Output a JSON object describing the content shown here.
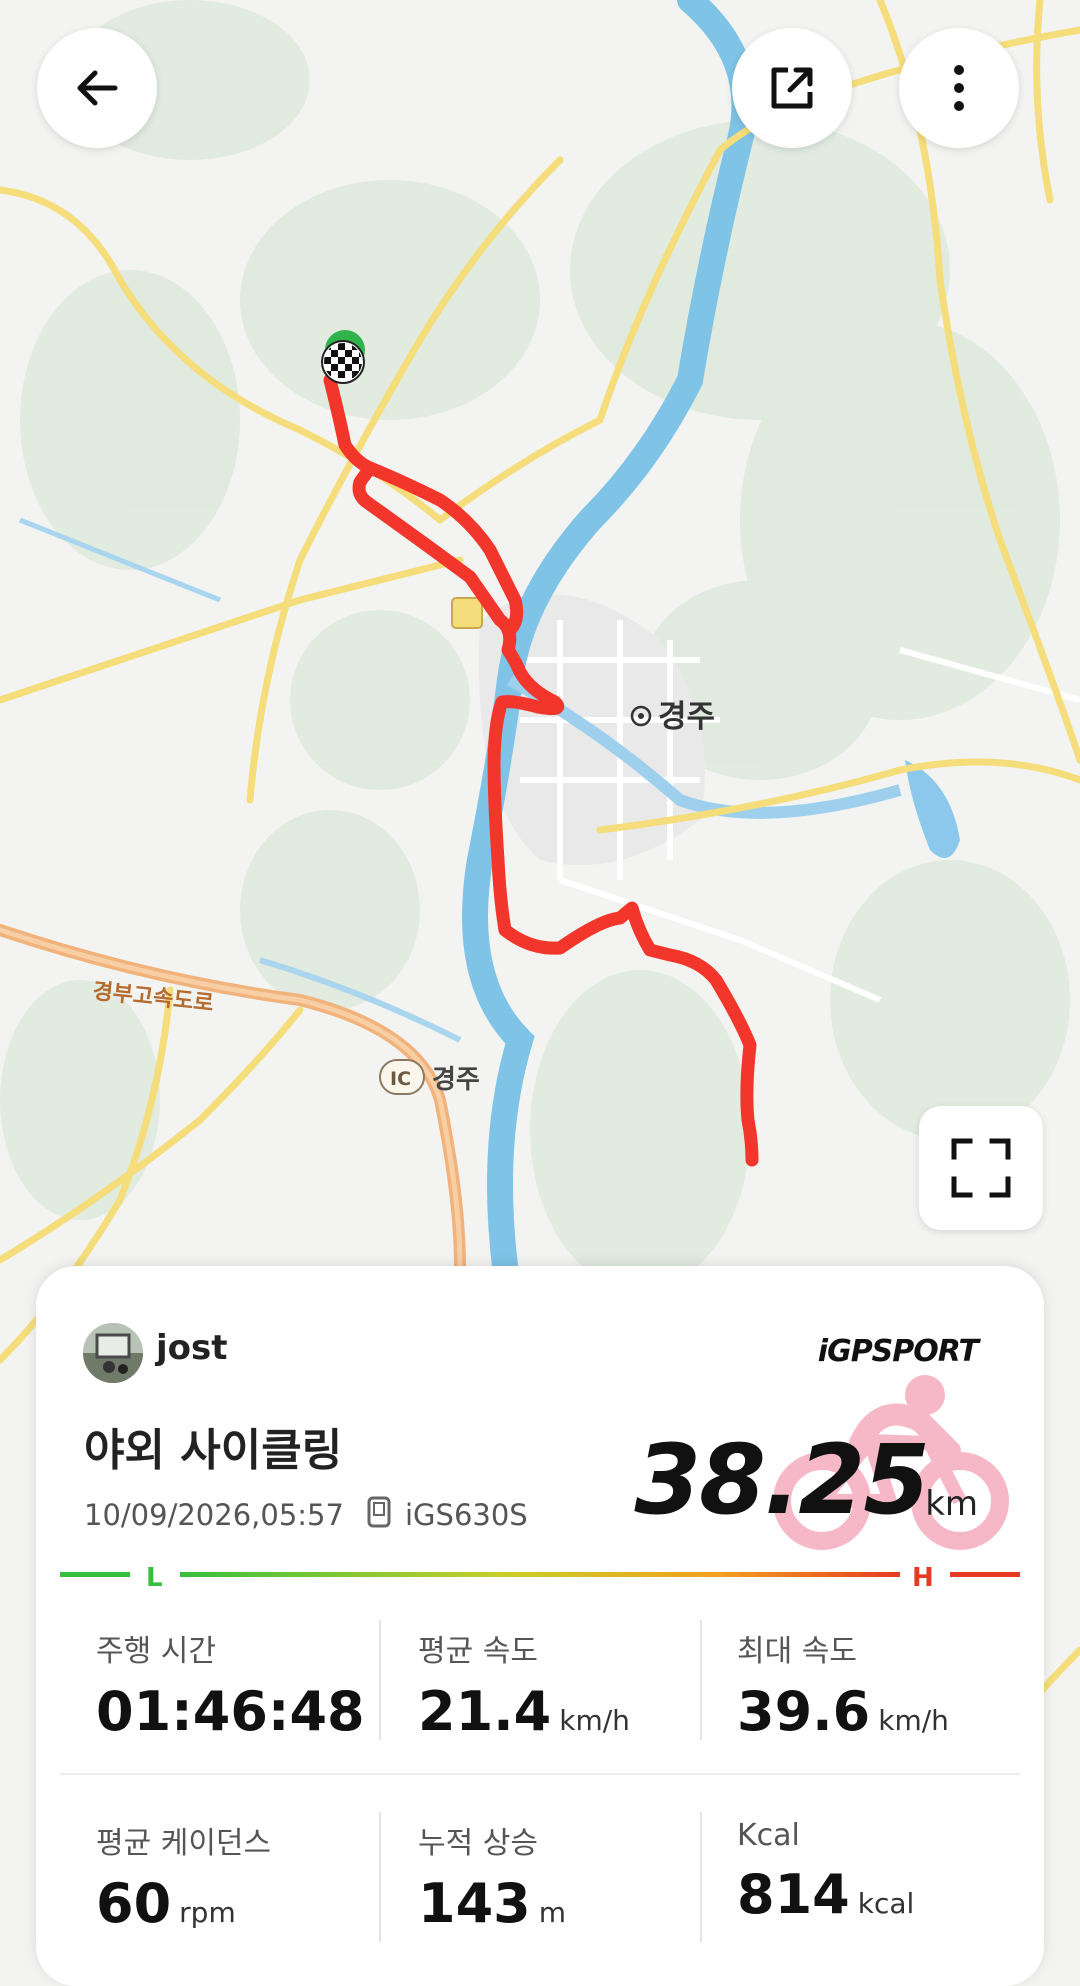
{
  "map": {
    "city_label": "경주",
    "highway_label": "경부고속도로",
    "interchange_icon": "IC",
    "interchange_label": "경주"
  },
  "controls": {
    "back_icon": "arrow-left-icon",
    "share_icon": "share-icon",
    "more_icon": "more-vertical-icon",
    "fullscreen_icon": "fullscreen-icon"
  },
  "activity": {
    "username": "jost",
    "brand": "iGPSPORT",
    "title": "야외 사이클링",
    "datetime": "10/09/2026,05:57",
    "device": "iGS630S",
    "distance": "38.25",
    "distance_unit": "km",
    "scale_low": "L",
    "scale_high": "H"
  },
  "stats": [
    {
      "label": "주행 시간",
      "value": "01:46:48",
      "unit": ""
    },
    {
      "label": "평균 속도",
      "value": "21.4",
      "unit": "km/h"
    },
    {
      "label": "최대 속도",
      "value": "39.6",
      "unit": "km/h"
    },
    {
      "label": "평균 케이던스",
      "value": "60",
      "unit": "rpm"
    },
    {
      "label": "누적 상승",
      "value": "143",
      "unit": "m"
    },
    {
      "label": "Kcal",
      "value": "814",
      "unit": "kcal"
    }
  ],
  "colors": {
    "route": "#f3362b",
    "river": "#7fc3e6",
    "road_major": "#f4dd7a",
    "highway": "#f2b27c",
    "scale_low": "#37c03f",
    "scale_high": "#e63b22"
  }
}
